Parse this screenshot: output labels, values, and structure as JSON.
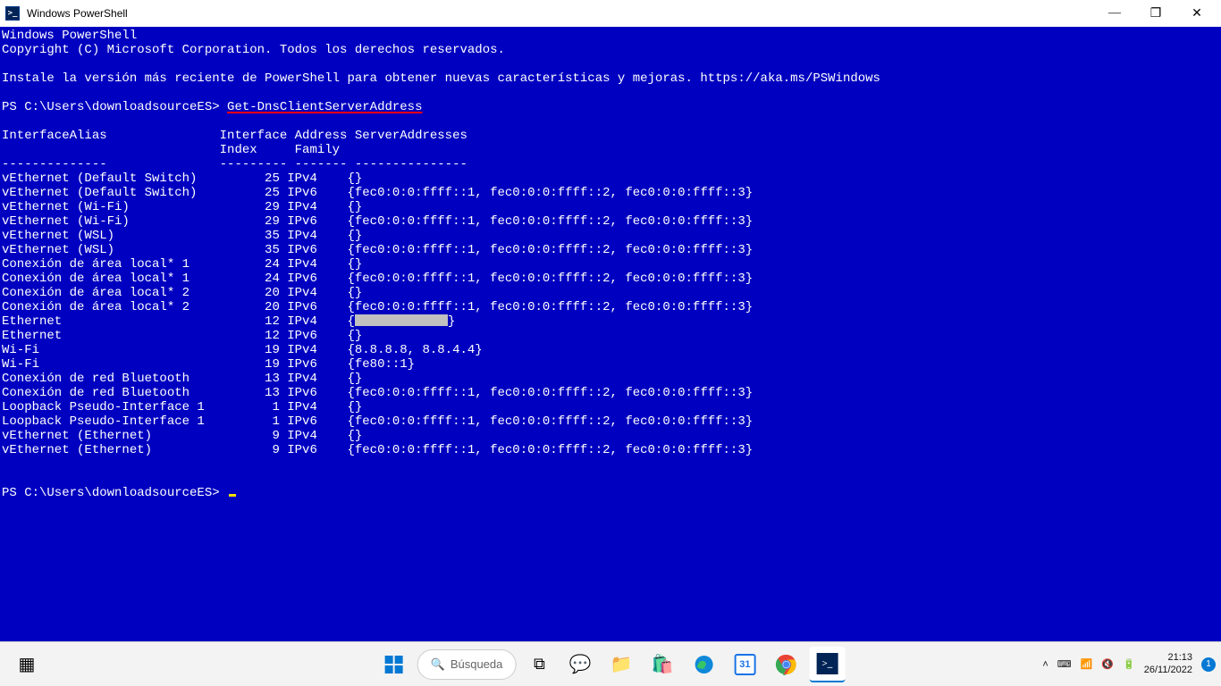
{
  "window": {
    "title": "Windows PowerShell",
    "icon_label": ">_"
  },
  "console": {
    "banner1": "Windows PowerShell",
    "banner2": "Copyright (C) Microsoft Corporation. Todos los derechos reservados.",
    "tip": "Instale la versión más reciente de PowerShell para obtener nuevas características y mejoras. https://aka.ms/PSWindows",
    "prompt_path": "PS C:\\Users\\downloadsourceES>",
    "command": "Get-DnsClientServerAddress",
    "header_line1": "InterfaceAlias               Interface Address ServerAddresses",
    "header_line2": "                             Index     Family",
    "divider": "--------------               --------- ------- ---------------",
    "rows": [
      {
        "alias": "vEthernet (Default Switch)",
        "idx": "25",
        "fam": "IPv4",
        "srv": "{}"
      },
      {
        "alias": "vEthernet (Default Switch)",
        "idx": "25",
        "fam": "IPv6",
        "srv": "{fec0:0:0:ffff::1, fec0:0:0:ffff::2, fec0:0:0:ffff::3}"
      },
      {
        "alias": "vEthernet (Wi-Fi)",
        "idx": "29",
        "fam": "IPv4",
        "srv": "{}"
      },
      {
        "alias": "vEthernet (Wi-Fi)",
        "idx": "29",
        "fam": "IPv6",
        "srv": "{fec0:0:0:ffff::1, fec0:0:0:ffff::2, fec0:0:0:ffff::3}"
      },
      {
        "alias": "vEthernet (WSL)",
        "idx": "35",
        "fam": "IPv4",
        "srv": "{}"
      },
      {
        "alias": "vEthernet (WSL)",
        "idx": "35",
        "fam": "IPv6",
        "srv": "{fec0:0:0:ffff::1, fec0:0:0:ffff::2, fec0:0:0:ffff::3}"
      },
      {
        "alias": "Conexión de área local* 1",
        "idx": "24",
        "fam": "IPv4",
        "srv": "{}"
      },
      {
        "alias": "Conexión de área local* 1",
        "idx": "24",
        "fam": "IPv6",
        "srv": "{fec0:0:0:ffff::1, fec0:0:0:ffff::2, fec0:0:0:ffff::3}"
      },
      {
        "alias": "Conexión de área local* 2",
        "idx": "20",
        "fam": "IPv4",
        "srv": "{}"
      },
      {
        "alias": "Conexión de área local* 2",
        "idx": "20",
        "fam": "IPv6",
        "srv": "{fec0:0:0:ffff::1, fec0:0:0:ffff::2, fec0:0:0:ffff::3}"
      },
      {
        "alias": "Ethernet",
        "idx": "12",
        "fam": "IPv4",
        "srv": "REDACTED"
      },
      {
        "alias": "Ethernet",
        "idx": "12",
        "fam": "IPv6",
        "srv": "{}"
      },
      {
        "alias": "Wi-Fi",
        "idx": "19",
        "fam": "IPv4",
        "srv": "{8.8.8.8, 8.8.4.4}"
      },
      {
        "alias": "Wi-Fi",
        "idx": "19",
        "fam": "IPv6",
        "srv": "{fe80::1}"
      },
      {
        "alias": "Conexión de red Bluetooth",
        "idx": "13",
        "fam": "IPv4",
        "srv": "{}"
      },
      {
        "alias": "Conexión de red Bluetooth",
        "idx": "13",
        "fam": "IPv6",
        "srv": "{fec0:0:0:ffff::1, fec0:0:0:ffff::2, fec0:0:0:ffff::3}"
      },
      {
        "alias": "Loopback Pseudo-Interface 1",
        "idx": "1",
        "fam": "IPv4",
        "srv": "{}"
      },
      {
        "alias": "Loopback Pseudo-Interface 1",
        "idx": "1",
        "fam": "IPv6",
        "srv": "{fec0:0:0:ffff::1, fec0:0:0:ffff::2, fec0:0:0:ffff::3}"
      },
      {
        "alias": "vEthernet (Ethernet)",
        "idx": "9",
        "fam": "IPv4",
        "srv": "{}"
      },
      {
        "alias": "vEthernet (Ethernet)",
        "idx": "9",
        "fam": "IPv6",
        "srv": "{fec0:0:0:ffff::1, fec0:0:0:ffff::2, fec0:0:0:ffff::3}"
      }
    ],
    "prompt2": "PS C:\\Users\\downloadsourceES>"
  },
  "taskbar": {
    "search_placeholder": "Búsqueda",
    "calendar_day": "31",
    "time": "21:13",
    "date": "26/11/2022",
    "notif_count": "1"
  }
}
